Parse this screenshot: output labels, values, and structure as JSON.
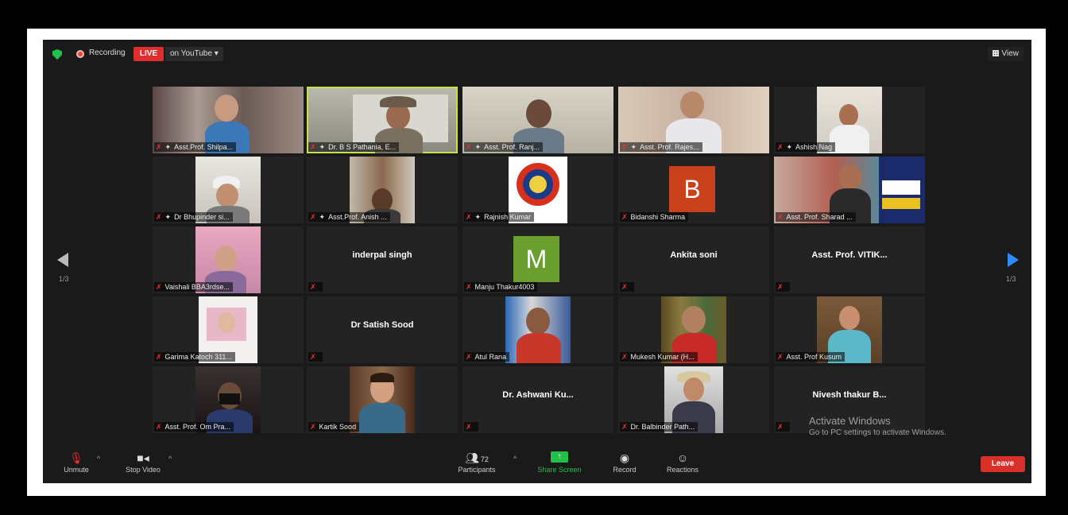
{
  "topbar": {
    "recording_label": "Recording",
    "live_label": "LIVE",
    "stream_target": "on YouTube ▾",
    "view_label": "View"
  },
  "pagination": {
    "left": "1/3",
    "right": "1/3"
  },
  "tiles": [
    {
      "name": "Asst.Prof. Shilpa...",
      "pinned": true
    },
    {
      "name": "Dr. B S Pathania, E...",
      "pinned": true
    },
    {
      "name": "Asst. Prof. Ranj...",
      "pinned": true
    },
    {
      "name": "Asst. Prof. Rajes...",
      "pinned": true
    },
    {
      "name": "Ashish Nag",
      "pinned": true
    },
    {
      "name": "Dr Bhupinder si...",
      "pinned": true
    },
    {
      "name": "Asst.Prof. Anish ...",
      "pinned": true
    },
    {
      "name": "Rajnish Kumar",
      "pinned": true
    },
    {
      "name": "Bidanshi Sharma",
      "avatar_letter": "B"
    },
    {
      "name": "Asst. Prof. Sharad ..."
    },
    {
      "name": "Vaishali BBA3rdse..."
    },
    {
      "display_text": "inderpal singh"
    },
    {
      "name": "Manju Thakur4003",
      "avatar_letter": "M"
    },
    {
      "display_text": "Ankita soni"
    },
    {
      "display_text": "Asst. Prof. VITIK..."
    },
    {
      "name": "Garima Katoch 311..."
    },
    {
      "display_text": "Dr Satish Sood"
    },
    {
      "name": "Atul Rana"
    },
    {
      "name": "Mukesh Kumar (H..."
    },
    {
      "name": "Asst. Prof Kusum"
    },
    {
      "name": "Asst. Prof. Om Pra..."
    },
    {
      "name": "Kartik Sood"
    },
    {
      "display_text": "Dr. Ashwani Ku..."
    },
    {
      "name": "Dr. Balbinder Path..."
    },
    {
      "display_text": "Nivesh thakur B..."
    }
  ],
  "watermark": {
    "title": "Activate Windows",
    "subtitle": "Go to PC settings to activate Windows."
  },
  "controls": {
    "unmute": "Unmute",
    "stop_video": "Stop Video",
    "participants_count": "72",
    "participants": "Participants",
    "share_screen": "Share Screen",
    "record": "Record",
    "reactions": "Reactions",
    "leave": "Leave"
  },
  "colors": {
    "live": "#e02d2d",
    "share": "#23c04a",
    "leave": "#d8302a",
    "active_speaker": "#c9e04a",
    "avatar_b": "#c8401c",
    "avatar_m": "#6a9e2e"
  }
}
